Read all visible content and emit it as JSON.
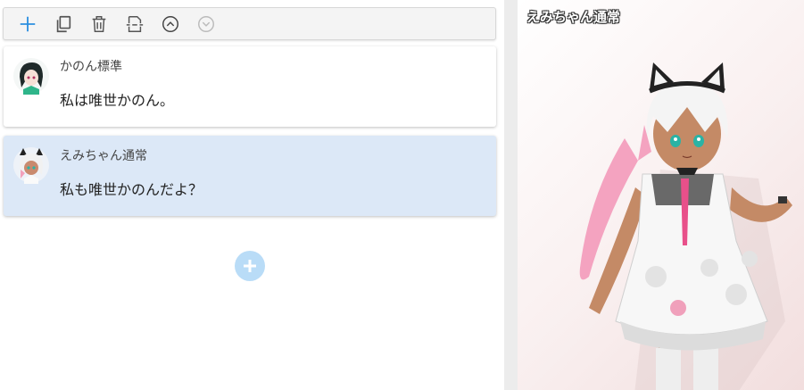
{
  "toolbar": {
    "buttons": [
      {
        "name": "add-icon"
      },
      {
        "name": "copy-icon"
      },
      {
        "name": "trash-icon"
      },
      {
        "name": "split-icon"
      },
      {
        "name": "move-up-icon"
      },
      {
        "name": "move-down-icon"
      }
    ]
  },
  "messages": [
    {
      "speaker": "かのん標準",
      "text": "私は唯世かのん。"
    },
    {
      "speaker": "えみちゃん通常",
      "text": "私も唯世かのんだよ？"
    }
  ],
  "preview": {
    "title": "えみちゃん通常"
  },
  "colors": {
    "accent": "#2c8fe0",
    "selected": "#dce8f7",
    "add_circle": "#b9dcf7"
  }
}
